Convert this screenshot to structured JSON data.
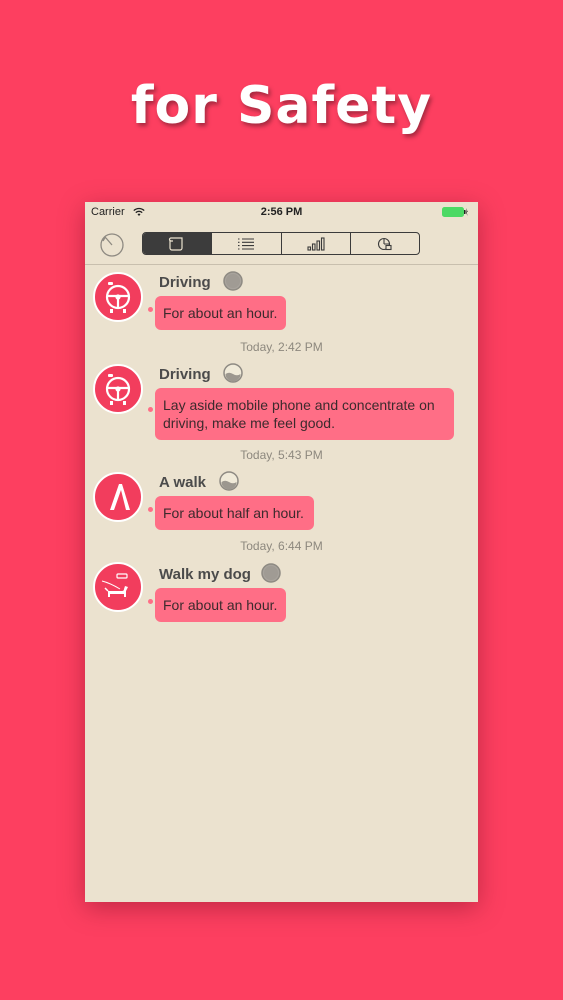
{
  "headline": "for Safety",
  "status_bar": {
    "carrier": "Carrier",
    "time": "2:56 PM"
  },
  "nav": {
    "tabs": [
      "journal-icon",
      "list-icon",
      "bar-chart-icon",
      "pie-chart-icon"
    ],
    "active_tab": 0
  },
  "entries": [
    {
      "activity": "Driving",
      "icon": "steering-wheel-icon",
      "indicator": "empty-circle-indicator",
      "message": "For about an hour.",
      "timestamp": "Today, 2:42 PM"
    },
    {
      "activity": "Driving",
      "icon": "steering-wheel-icon",
      "indicator": "half-filled-indicator",
      "message": "Lay aside mobile phone and concentrate on driving, make me feel good.",
      "timestamp": "Today, 5:43 PM"
    },
    {
      "activity": "A walk",
      "icon": "walking-icon",
      "indicator": "half-filled-indicator",
      "message": "For about half an hour.",
      "timestamp": "Today, 6:44 PM"
    },
    {
      "activity": "Walk my dog",
      "icon": "dog-walk-icon",
      "indicator": "empty-circle-indicator",
      "message": "For about an hour."
    }
  ],
  "colors": {
    "background": "#fd3f60",
    "screen": "#ebe2cf",
    "bubble": "#ff6e86",
    "avatar": "#f23d5d"
  }
}
